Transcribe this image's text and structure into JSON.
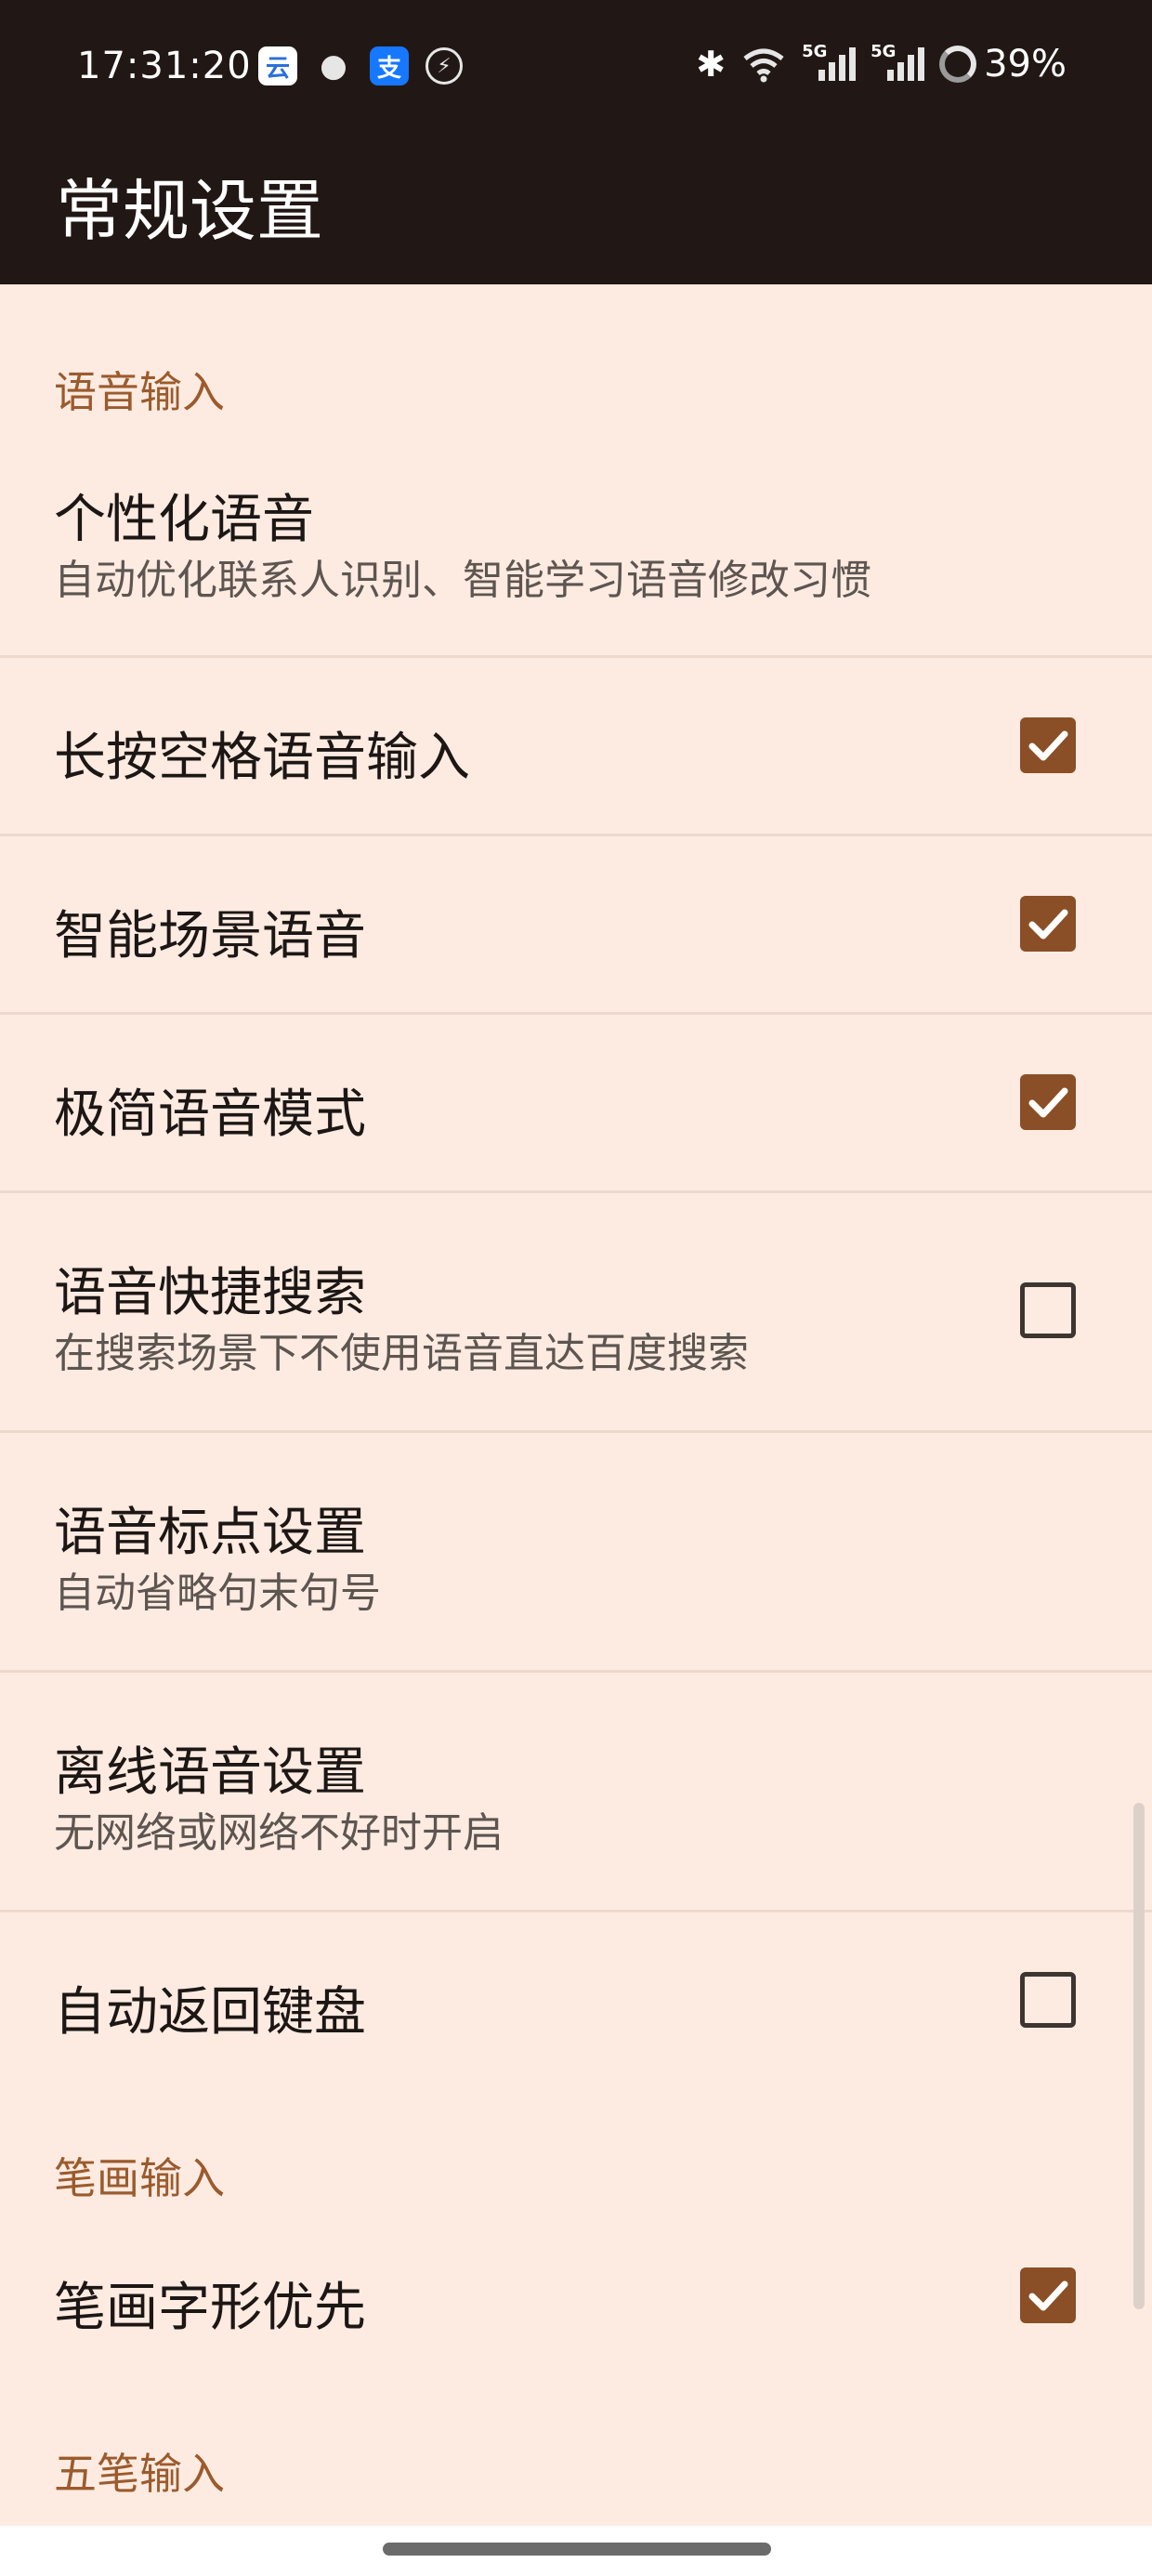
{
  "status_bar": {
    "time": "17:31:20",
    "battery": "39%",
    "network_1": "5G",
    "network_2": "5G",
    "notification_icons": [
      "ticket-app-icon",
      "android-icon",
      "alipay-icon",
      "power-saving-icon"
    ],
    "system_icons": [
      "bluetooth-icon",
      "wifi-icon",
      "signal-icon",
      "signal-icon",
      "battery-icon"
    ]
  },
  "app_bar": {
    "title": "常规设置"
  },
  "sections": {
    "voice": {
      "header": "语音输入"
    },
    "stroke": {
      "header": "笔画输入"
    },
    "wubi": {
      "header": "五笔输入"
    }
  },
  "items": {
    "personalized_voice": {
      "title": "个性化语音",
      "subtitle": "自动优化联系人识别、智能学习语音修改习惯"
    },
    "long_press_space": {
      "title": "长按空格语音输入",
      "checked": true
    },
    "smart_scene": {
      "title": "智能场景语音",
      "checked": true
    },
    "minimal_mode": {
      "title": "极简语音模式",
      "checked": true
    },
    "quick_search": {
      "title": "语音快捷搜索",
      "subtitle": "在搜索场景下不使用语音直达百度搜索",
      "checked": false
    },
    "punctuation": {
      "title": "语音标点设置",
      "subtitle": "自动省略句末句号"
    },
    "offline": {
      "title": "离线语音设置",
      "subtitle": "无网络或网络不好时开启"
    },
    "auto_return": {
      "title": "自动返回键盘",
      "checked": false
    },
    "stroke_priority": {
      "title": "笔画字形优先",
      "checked": true
    }
  },
  "colors": {
    "accent": "#8a4f26",
    "section_header": "#9b5b2d",
    "background": "#fdebe2",
    "top_bar": "#211815"
  }
}
